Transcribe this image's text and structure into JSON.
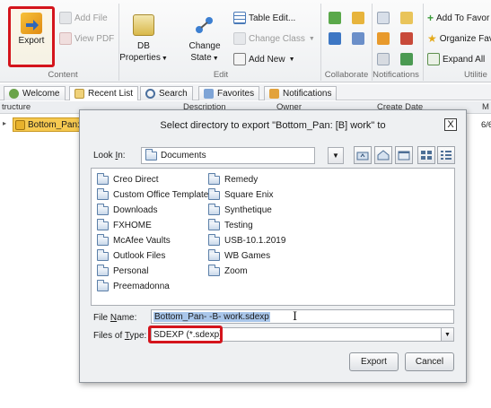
{
  "ribbon": {
    "content_group": {
      "label": "Content",
      "export": "Export",
      "add_file": "Add File",
      "view_pdf": "View PDF"
    },
    "edit_group": {
      "label": "Edit",
      "db_properties_line1": "DB",
      "db_properties_line2": "Properties",
      "change_state_line1": "Change",
      "change_state_line2": "State",
      "table_edit": "Table Edit...",
      "change_class": "Change Class",
      "add_new": "Add New"
    },
    "collaborate_group": {
      "label": "Collaborate"
    },
    "notifications_group": {
      "label": "Notifications"
    },
    "utilities_group": {
      "label": "Utilitie",
      "add_to_favorites": "Add To Favor",
      "organize_favorites": "Organize Fav",
      "expand_all": "Expand All"
    }
  },
  "tabs": [
    {
      "label": "Welcome"
    },
    {
      "label": "Recent List"
    },
    {
      "label": "Search"
    },
    {
      "label": "Favorites"
    },
    {
      "label": "Notifications"
    }
  ],
  "grid": {
    "columns": [
      "tructure",
      "Description",
      "Owner",
      "Create Date",
      "M"
    ],
    "row": {
      "name": "Bottom_Pan:",
      "trail": "6/6"
    }
  },
  "dialog": {
    "title": "Select directory to export \"Bottom_Pan: [B] work\" to",
    "close": "X",
    "look_in_label_pre": "Look ",
    "look_in_label_u": "I",
    "look_in_label_post": "n:",
    "look_in_value": "Documents",
    "folders_col1": [
      "Creo Direct",
      "Custom Office Templates",
      "Downloads",
      "FXHOME",
      "McAfee Vaults",
      "Outlook Files",
      "Personal",
      "Preemadonna"
    ],
    "folders_col2": [
      "Remedy",
      "Square Enix",
      "Synthetique",
      "Testing",
      "USB-10.1.2019",
      "WB Games",
      "Zoom"
    ],
    "file_name_label_pre": "File ",
    "file_name_label_u": "N",
    "file_name_label_post": "ame:",
    "file_name_value": "Bottom_Pan- -B- work.sdexp",
    "file_type_label_pre": "Files of ",
    "file_type_label_u": "T",
    "file_type_label_post": "ype:",
    "file_type_value": "SDEXP (*.sdexp)",
    "export_button": "Export",
    "cancel_button": "Cancel"
  },
  "colors": {
    "highlight_red": "#d4141c",
    "selection_blue": "#a9c6ea",
    "row_selected": "#f6c950"
  }
}
